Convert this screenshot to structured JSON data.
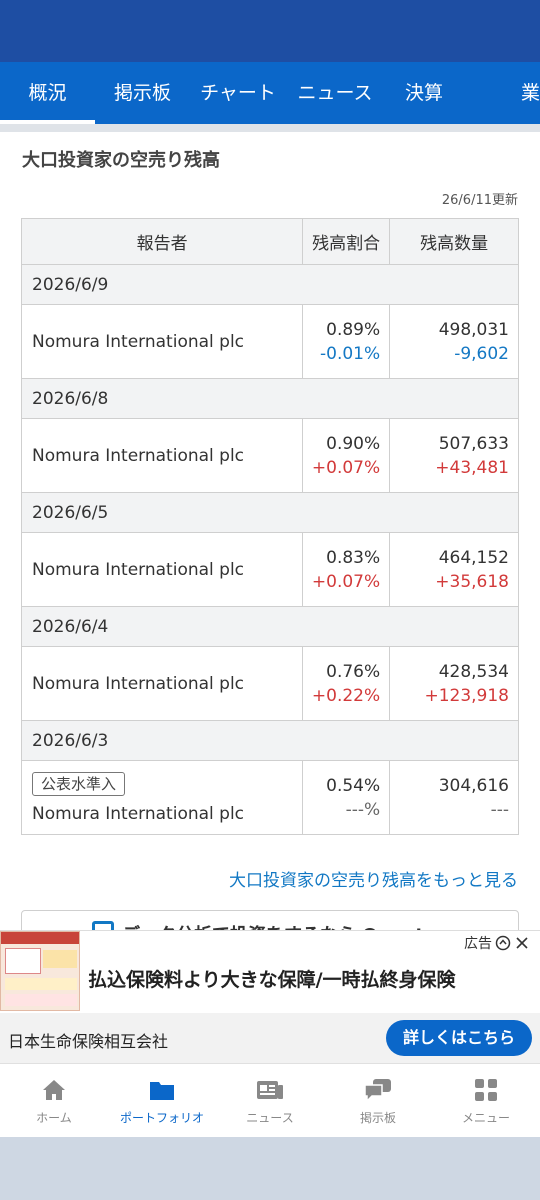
{
  "tabs": [
    {
      "label": "概況",
      "active": true
    },
    {
      "label": "掲示板",
      "active": false
    },
    {
      "label": "チャート",
      "active": false
    },
    {
      "label": "ニュース",
      "active": false
    },
    {
      "label": "決算",
      "active": false
    },
    {
      "label": "業",
      "active": false
    }
  ],
  "section": {
    "title": "大口投資家の空売り残高",
    "updated": "26/6/11更新"
  },
  "table": {
    "headers": {
      "reporter": "報告者",
      "ratio": "残高割合",
      "quantity": "残高数量"
    },
    "groups": [
      {
        "date": "2026/6/9",
        "reporter": "Nomura International plc",
        "badge": "",
        "ratio": "0.89%",
        "ratio_change": "-0.01%",
        "quantity": "498,031",
        "quantity_change": "-9,602"
      },
      {
        "date": "2026/6/8",
        "reporter": "Nomura International plc",
        "badge": "",
        "ratio": "0.90%",
        "ratio_change": "+0.07%",
        "quantity": "507,633",
        "quantity_change": "+43,481"
      },
      {
        "date": "2026/6/5",
        "reporter": "Nomura International plc",
        "badge": "",
        "ratio": "0.83%",
        "ratio_change": "+0.07%",
        "quantity": "464,152",
        "quantity_change": "+35,618"
      },
      {
        "date": "2026/6/4",
        "reporter": "Nomura International plc",
        "badge": "",
        "ratio": "0.76%",
        "ratio_change": "+0.22%",
        "quantity": "428,534",
        "quantity_change": "+123,918"
      },
      {
        "date": "2026/6/3",
        "reporter": "Nomura International plc",
        "badge": "公表水準入",
        "ratio": "0.54%",
        "ratio_change": "---%",
        "quantity": "304,616",
        "quantity_change": "---"
      }
    ]
  },
  "more_link": "大口投資家の空売り残高をもっと見る",
  "quants_banner": "データ分析で投資をするなら Quants",
  "ad": {
    "label": "広告",
    "headline": "払込保険料より大きな保障/一時払終身保険",
    "company": "日本生命保険相互会社",
    "cta": "詳しくはこちら"
  },
  "bottom_nav": [
    {
      "label": "ホーム",
      "icon": "home-icon",
      "active": false
    },
    {
      "label": "ポートフォリオ",
      "icon": "folder-icon",
      "active": true
    },
    {
      "label": "ニュース",
      "icon": "news-icon",
      "active": false
    },
    {
      "label": "掲示板",
      "icon": "chat-icon",
      "active": false
    },
    {
      "label": "メニュー",
      "icon": "menu-grid-icon",
      "active": false
    }
  ],
  "colors": {
    "brand": "#0b67c9",
    "header": "#1e4ea3",
    "negative": "#1478c4",
    "positive": "#d23a3a"
  }
}
